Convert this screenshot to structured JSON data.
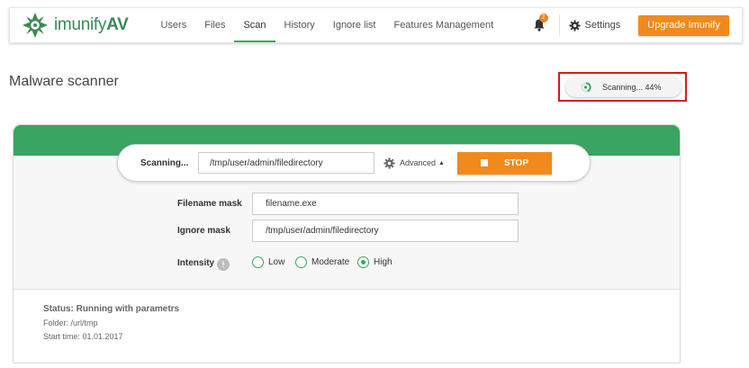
{
  "brand": {
    "name_light": "imunify",
    "name_bold": "AV"
  },
  "nav": {
    "items": [
      {
        "label": "Users",
        "active": false
      },
      {
        "label": "Files",
        "active": false
      },
      {
        "label": "Scan",
        "active": true
      },
      {
        "label": "History",
        "active": false
      },
      {
        "label": "Ignore list",
        "active": false
      },
      {
        "label": "Features Management",
        "active": false
      }
    ]
  },
  "header": {
    "notifications_count": "2",
    "settings_label": "Settings",
    "upgrade_label": "Upgrade Imunify"
  },
  "page": {
    "title": "Malware scanner",
    "status_pill": "Scanning... 44%"
  },
  "scan": {
    "label": "Scanning...",
    "path_value": "/tmp/user/admin/filedirectory",
    "advanced_label": "Advanced",
    "stop_label": "STOP"
  },
  "form": {
    "filename_mask_label": "Filename mask",
    "filename_mask_value": "filename.exe",
    "ignore_mask_label": "Ignore mask",
    "ignore_mask_value": "/tmp/user/admin/filedirectory",
    "intensity_label": "Intensity",
    "intensity_info": "!",
    "intensity_options": [
      {
        "label": "Low",
        "selected": false
      },
      {
        "label": "Moderate",
        "selected": false
      },
      {
        "label": "High",
        "selected": true
      }
    ]
  },
  "status": {
    "title": "Status: Running with parametrs",
    "folder": "Folder: /url/tmp",
    "start_time": "Start time: 01.01.2017"
  },
  "colors": {
    "brand_green": "#3aa562",
    "accent_orange": "#f18a1c",
    "highlight_red": "#d41c1c"
  }
}
